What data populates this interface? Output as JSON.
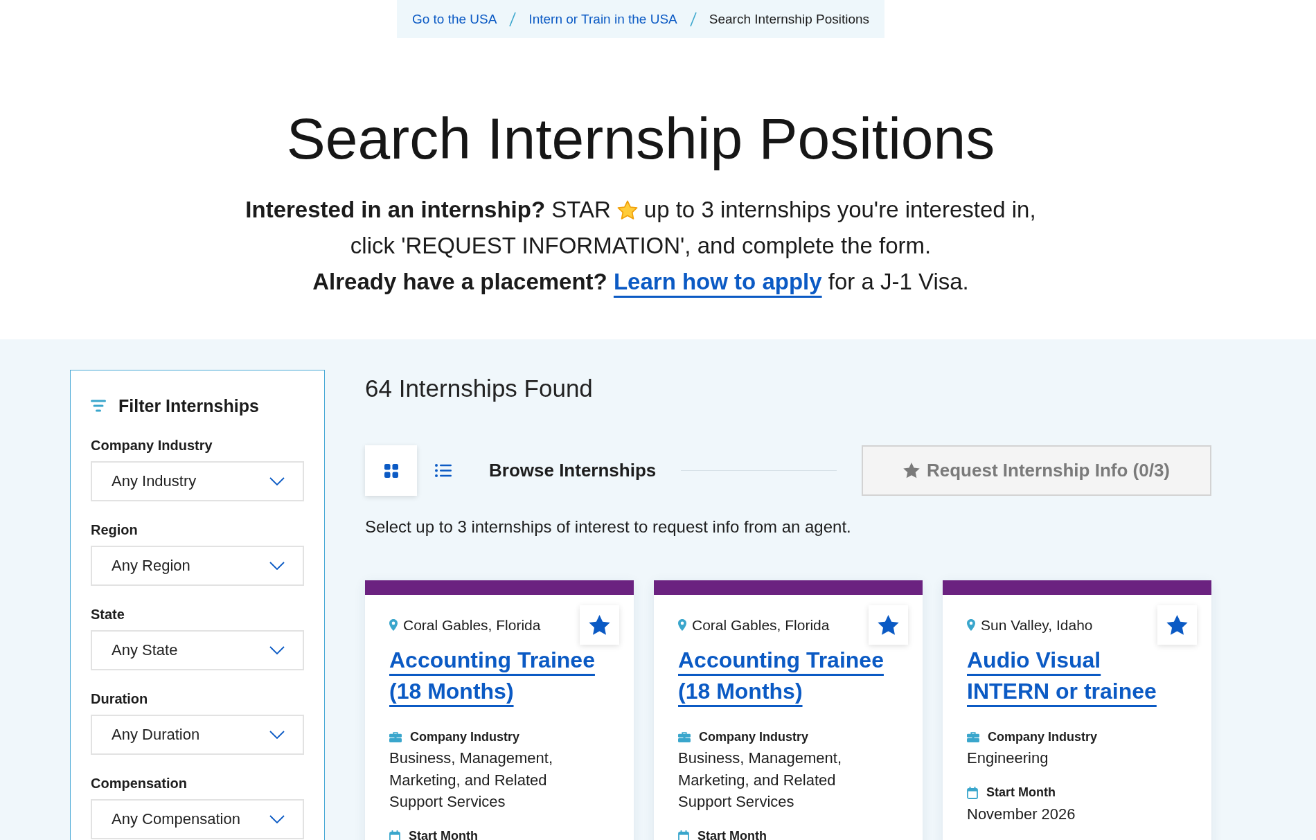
{
  "breadcrumb": [
    {
      "label": "Go to the USA",
      "current": false
    },
    {
      "label": "Intern or Train in the USA",
      "current": false
    },
    {
      "label": "Search Internship Positions",
      "current": true
    }
  ],
  "page_title": "Search Internship Positions",
  "intro": {
    "line_1_before_star": "**Interested in an internship?** STAR",
    "line_1_after_star": "up to 3 internships you're interested in,",
    "line_2": "click 'REQUEST INFORMATION', and complete the form.",
    "line_3_lead": "Already have a placement?",
    "line_3_link": "Learn how to apply",
    "line_3_tail": "for a J-1 Visa."
  },
  "filter_panel": {
    "title": "Filter Internships",
    "filters": [
      {
        "label": "Company Industry",
        "value": "Any Industry"
      },
      {
        "label": "Region",
        "value": "Any Region"
      },
      {
        "label": "State",
        "value": "Any State"
      },
      {
        "label": "Duration",
        "value": "Any Duration"
      },
      {
        "label": "Compensation",
        "value": "Any Compensation"
      }
    ]
  },
  "results_count": "64 Internships Found",
  "toolbar": {
    "view_modes": [
      {
        "kind": "grid",
        "selected": true
      },
      {
        "kind": "list",
        "selected": false
      }
    ],
    "title": "Browse Internships",
    "request_button": {
      "label": "Request Internship Info (0/3)",
      "disabled": true
    }
  },
  "hint": "Select up to 3 internships of interest to request info from an agent.",
  "cards": [
    {
      "location": "Coral Gables, Florida",
      "starred": false,
      "title": "Accounting Trainee (18 Months)",
      "details": [
        {
          "kind": "industry",
          "label": "Company Industry",
          "value": "Business, Management, Marketing, and Related Support Services"
        },
        {
          "kind": "start_month",
          "label": "Start Month"
        }
      ]
    },
    {
      "location": "Coral Gables, Florida",
      "starred": false,
      "title": "Accounting Trainee (18 Months)",
      "details": [
        {
          "kind": "industry",
          "label": "Company Industry",
          "value": "Business, Management, Marketing, and Related Support Services"
        },
        {
          "kind": "start_month",
          "label": "Start Month"
        }
      ]
    },
    {
      "location": "Sun Valley, Idaho",
      "starred": false,
      "title": "Audio Visual INTERN or trainee",
      "details": [
        {
          "kind": "industry",
          "label": "Company Industry",
          "value": "Engineering"
        },
        {
          "kind": "start_month",
          "label": "Start Month",
          "value": "November 2026"
        }
      ]
    }
  ]
}
